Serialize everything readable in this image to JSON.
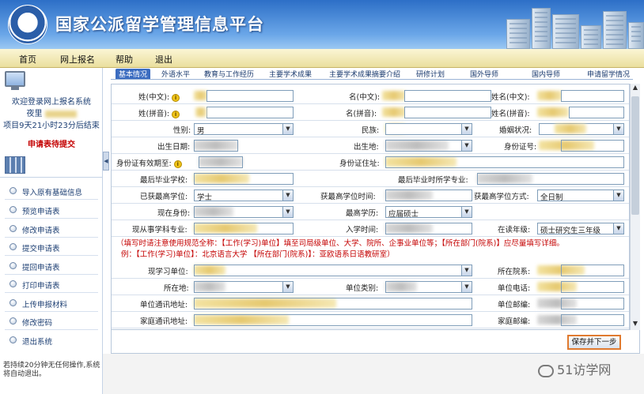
{
  "header": {
    "title": "国家公派留学管理信息平台"
  },
  "nav": [
    "首页",
    "网上报名",
    "帮助",
    "退出"
  ],
  "sidebar": {
    "welcome": "欢迎登录网上报名系统",
    "user": "夜里",
    "deadline": "项目9天21小时23分后结束",
    "status": "申请表待提交",
    "menu": [
      "导入原有基础信息",
      "预览申请表",
      "修改申请表",
      "提交申请表",
      "提回申请表",
      "打印申请表",
      "上传申报材料",
      "修改密码",
      "退出系统"
    ],
    "timeout": "若持续20分钟无任何操作,系统将自动退出。"
  },
  "tabs": [
    "基本情况",
    "外语水平",
    "教育与工作经历",
    "主要学术成果",
    "主要学术成果摘要介绍",
    "研修计划",
    "国外导师",
    "国内导师",
    "申请留学情况"
  ],
  "form": {
    "name_cn": "姓(中文)",
    "given_cn": "名(中文)",
    "full_cn": "姓名(中文)",
    "name_py": "姓(拼音)",
    "given_py": "名(拼音)",
    "full_py": "姓名(拼音)",
    "gender": "性别",
    "gender_value": "男",
    "ethnic": "民族",
    "marital": "婚姻状况",
    "birthdate": "出生日期",
    "birthplace": "出生地",
    "id_no": "身份证号",
    "id_valid": "身份证有效期至",
    "id_addr": "身份证住址",
    "last_school": "最后毕业学校",
    "last_major": "最后毕业时所学专业",
    "degree": "已获最高学位",
    "degree_value": "学士",
    "degree_time": "获最高学位时间",
    "degree_method": "获最高学位方式",
    "degree_method_value": "全日制",
    "identity": "现在身份",
    "education": "最高学历",
    "education_value": "应届硕士",
    "subject": "现从事学科专业",
    "enroll_time": "入学时间",
    "grade": "在读年级",
    "grade_value": "硕士研究生三年级",
    "note1": "（填写时请注意使用规范全称：【工作(学习)单位】填至司局级单位、大学、院所、企事业单位等；【所在部门(院系)】应尽量填写详细。",
    "note2": "例：【工作(学习)单位】：北京语言大学     【所在部门(院系)】：亚欧语系日语教研室）",
    "unit": "现学习单位",
    "dept": "所在院系",
    "location": "所在地",
    "unit_type": "单位类别",
    "unit_phone": "单位电话",
    "unit_addr": "单位通讯地址",
    "unit_zip": "单位邮编",
    "home_addr": "家庭通讯地址",
    "home_zip": "家庭邮编"
  },
  "actions": {
    "save_next": "保存并下一步"
  },
  "watermark": "51访学网"
}
